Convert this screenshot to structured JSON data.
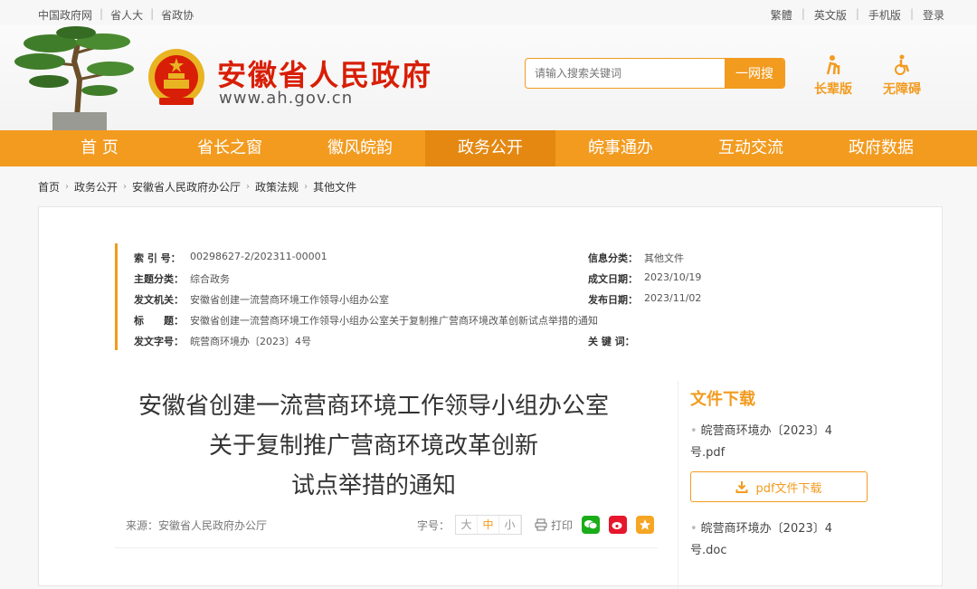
{
  "top_links_left": [
    "中国政府网",
    "省人大",
    "省政协"
  ],
  "top_links_right": [
    "繁體",
    "英文版",
    "手机版",
    "登录"
  ],
  "site": {
    "name": "安徽省人民政府",
    "url": "www.ah.gov.cn"
  },
  "search": {
    "placeholder": "请输入搜索关键词",
    "button": "一网搜"
  },
  "access": {
    "elder": "长辈版",
    "barrier_free": "无障碍"
  },
  "nav": [
    "首 页",
    "省长之窗",
    "徽风皖韵",
    "政务公开",
    "皖事通办",
    "互动交流",
    "政府数据"
  ],
  "nav_active_index": 3,
  "breadcrumb": [
    "首页",
    "政务公开",
    "安徽省人民政府办公厅",
    "政策法规",
    "其他文件"
  ],
  "meta": {
    "index_no_k": "索 引 号：",
    "index_no_v": "00298627-2/202311-00001",
    "topic_k": "主题分类：",
    "topic_v": "综合政务",
    "issuer_k": "发文机关：",
    "issuer_v": "安徽省创建一流营商环境工作领导小组办公室",
    "title_k": "标　　题：",
    "title_v": "安徽省创建一流营商环境工作领导小组办公室关于复制推广营商环境改革创新试点举措的通知",
    "doc_no_k": "发文字号：",
    "doc_no_v": "皖营商环境办〔2023〕4号",
    "info_cat_k": "信息分类：",
    "info_cat_v": "其他文件",
    "written_k": "成文日期：",
    "written_v": "2023/10/19",
    "published_k": "发布日期：",
    "published_v": "2023/11/02",
    "keywords_k": "关 键 词："
  },
  "doc": {
    "title_line1": "安徽省创建一流营商环境工作领导小组办公室",
    "title_line2": "关于复制推广营商环境改革创新",
    "title_line3": "试点举措的通知",
    "source": "来源：安徽省人民政府办公厅"
  },
  "tools": {
    "font_label": "字号：",
    "sizes": [
      "大",
      "中",
      "小"
    ],
    "print": "打印"
  },
  "downloads": {
    "title": "文件下载",
    "pdf_name_1": "皖营商环境办〔2023〕4",
    "pdf_name_2": "号.pdf",
    "pdf_button": "pdf文件下载",
    "doc_name_1": "皖营商环境办〔2023〕4",
    "doc_name_2": "号.doc"
  },
  "colors": {
    "accent": "#f29b1f",
    "brand_red": "#d81e06",
    "wechat": "#1aad19",
    "weibo": "#e6162d",
    "qzone": "#f5a623"
  }
}
